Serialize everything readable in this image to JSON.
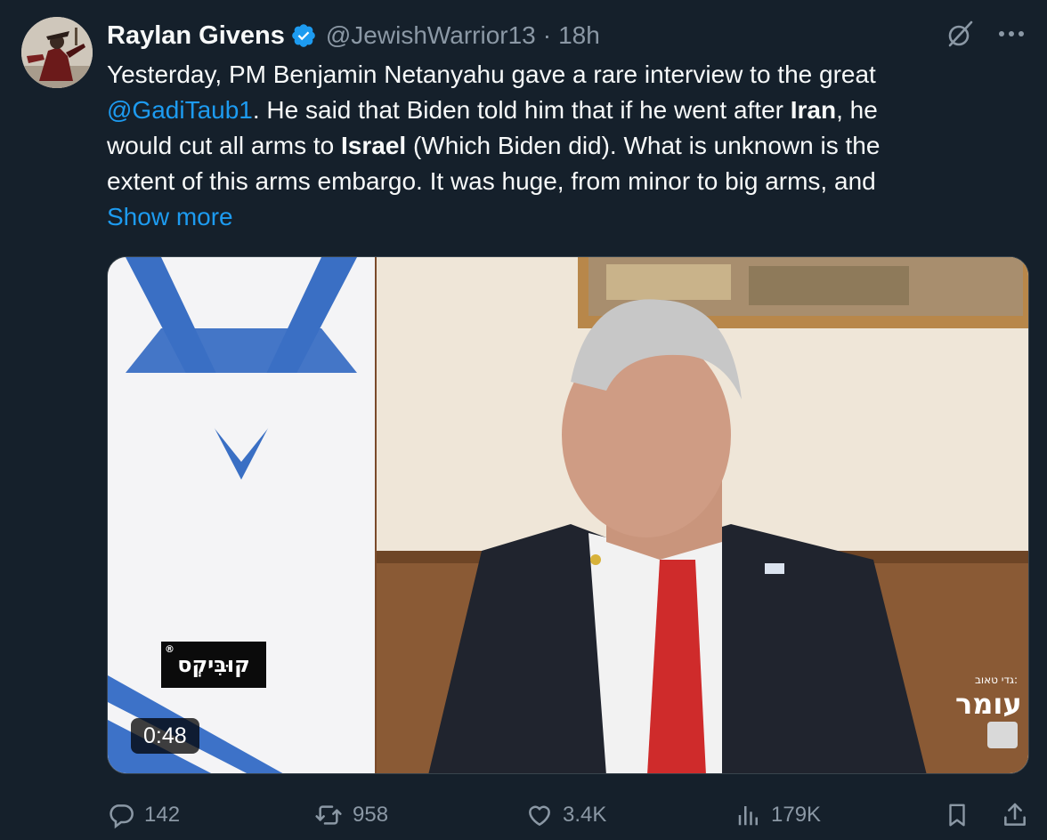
{
  "author": {
    "display_name": "Raylan Givens",
    "handle": "@JewishWarrior13",
    "separator": "·",
    "time": "18h",
    "verified": true,
    "avatar_icon": "avatar-image"
  },
  "top_actions": {
    "grok_icon": "grok-icon",
    "more_icon": "more-icon"
  },
  "tweet": {
    "line1": "Yesterday, PM Benjamin Netanyahu gave a rare interview to the great",
    "mention": "@GadiTaub1",
    "line2_a": ". He said that Biden told him that if he went after ",
    "iran": "Iran",
    "line2_b": ", he",
    "line3_a": "would cut all arms to ",
    "israel": "Israel",
    "line3_b": " (Which Biden did). What is unknown is the",
    "line4": "extent of this arms embargo. It was huge, from minor to big arms, and",
    "show_more": "Show more"
  },
  "media": {
    "type": "video",
    "duration": "0:48",
    "logo_text": "קוּבִּיקְס",
    "logo_reg": "®",
    "watermark_small": "גדי טאוב:",
    "watermark_big": "עומר"
  },
  "actions": {
    "replies": "142",
    "retweets": "958",
    "likes": "3.4K",
    "views": "179K"
  },
  "colors": {
    "background": "#15202b",
    "text": "#f7f9f9",
    "muted": "#8b98a5",
    "accent": "#1d9bf0"
  }
}
